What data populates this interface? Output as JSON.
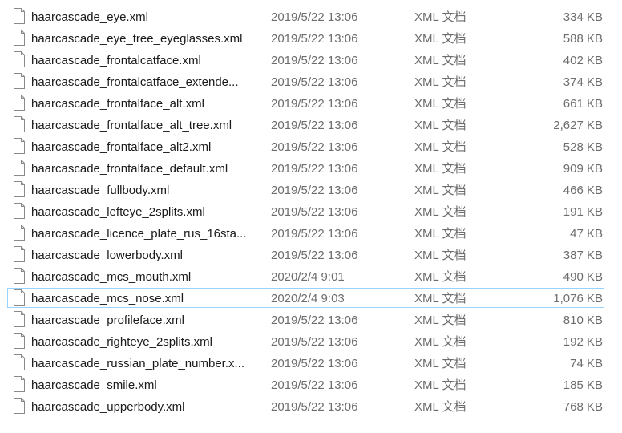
{
  "files": [
    {
      "name": "haarcascade_eye.xml",
      "date": "2019/5/22 13:06",
      "type": "XML 文档",
      "size": "334 KB"
    },
    {
      "name": "haarcascade_eye_tree_eyeglasses.xml",
      "date": "2019/5/22 13:06",
      "type": "XML 文档",
      "size": "588 KB"
    },
    {
      "name": "haarcascade_frontalcatface.xml",
      "date": "2019/5/22 13:06",
      "type": "XML 文档",
      "size": "402 KB"
    },
    {
      "name": "haarcascade_frontalcatface_extende...",
      "date": "2019/5/22 13:06",
      "type": "XML 文档",
      "size": "374 KB"
    },
    {
      "name": "haarcascade_frontalface_alt.xml",
      "date": "2019/5/22 13:06",
      "type": "XML 文档",
      "size": "661 KB"
    },
    {
      "name": "haarcascade_frontalface_alt_tree.xml",
      "date": "2019/5/22 13:06",
      "type": "XML 文档",
      "size": "2,627 KB"
    },
    {
      "name": "haarcascade_frontalface_alt2.xml",
      "date": "2019/5/22 13:06",
      "type": "XML 文档",
      "size": "528 KB"
    },
    {
      "name": "haarcascade_frontalface_default.xml",
      "date": "2019/5/22 13:06",
      "type": "XML 文档",
      "size": "909 KB"
    },
    {
      "name": "haarcascade_fullbody.xml",
      "date": "2019/5/22 13:06",
      "type": "XML 文档",
      "size": "466 KB"
    },
    {
      "name": "haarcascade_lefteye_2splits.xml",
      "date": "2019/5/22 13:06",
      "type": "XML 文档",
      "size": "191 KB"
    },
    {
      "name": "haarcascade_licence_plate_rus_16sta...",
      "date": "2019/5/22 13:06",
      "type": "XML 文档",
      "size": "47 KB"
    },
    {
      "name": "haarcascade_lowerbody.xml",
      "date": "2019/5/22 13:06",
      "type": "XML 文档",
      "size": "387 KB"
    },
    {
      "name": "haarcascade_mcs_mouth.xml",
      "date": "2020/2/4 9:01",
      "type": "XML 文档",
      "size": "490 KB"
    },
    {
      "name": "haarcascade_mcs_nose.xml",
      "date": "2020/2/4 9:03",
      "type": "XML 文档",
      "size": "1,076 KB",
      "focused": true
    },
    {
      "name": "haarcascade_profileface.xml",
      "date": "2019/5/22 13:06",
      "type": "XML 文档",
      "size": "810 KB"
    },
    {
      "name": "haarcascade_righteye_2splits.xml",
      "date": "2019/5/22 13:06",
      "type": "XML 文档",
      "size": "192 KB"
    },
    {
      "name": "haarcascade_russian_plate_number.x...",
      "date": "2019/5/22 13:06",
      "type": "XML 文档",
      "size": "74 KB"
    },
    {
      "name": "haarcascade_smile.xml",
      "date": "2019/5/22 13:06",
      "type": "XML 文档",
      "size": "185 KB"
    },
    {
      "name": "haarcascade_upperbody.xml",
      "date": "2019/5/22 13:06",
      "type": "XML 文档",
      "size": "768 KB"
    }
  ],
  "icons": {
    "file": "document-icon"
  },
  "colors": {
    "focus_border": "#99d1ff",
    "secondary_text": "#6d6d6d"
  }
}
